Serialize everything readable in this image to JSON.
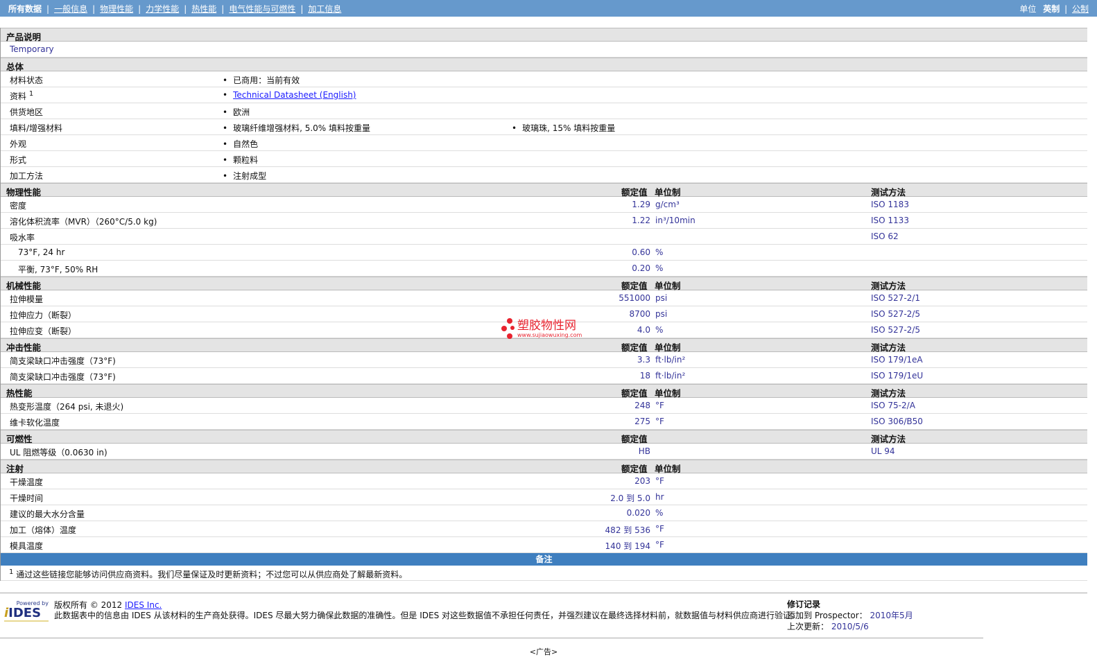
{
  "nav": {
    "items": [
      "所有数据",
      "一般信息",
      "物理性能",
      "力学性能",
      "热性能",
      "电气性能与可燃性",
      "加工信息"
    ],
    "right": {
      "label": "单位",
      "english": "英制",
      "metric": "公制"
    }
  },
  "product": {
    "title": "产品说明",
    "text": "Temporary"
  },
  "general": {
    "title": "总体",
    "rows": [
      {
        "label": "材料状态",
        "items": [
          "已商用：当前有效"
        ]
      },
      {
        "label": "资料",
        "sup": "1",
        "link": "Technical Datasheet (English)"
      },
      {
        "label": "供货地区",
        "items": [
          "欧洲"
        ]
      },
      {
        "label": "填料/增强材料",
        "items": [
          "玻璃纤维增强材料, 5.0% 填料按重量",
          "玻璃珠, 15% 填料按重量"
        ]
      },
      {
        "label": "外观",
        "items": [
          "自然色"
        ]
      },
      {
        "label": "形式",
        "items": [
          "颗粒料"
        ]
      },
      {
        "label": "加工方法",
        "items": [
          "注射成型"
        ]
      }
    ]
  },
  "headers": {
    "value": "额定值",
    "unit": "单位制",
    "method": "测试方法"
  },
  "sections": [
    {
      "title": "物理性能",
      "unit": true,
      "method": true,
      "rows": [
        {
          "label": "密度",
          "value": "1.29",
          "unit": "g/cm³",
          "method": "ISO 1183"
        },
        {
          "label": "溶化体积流率（MVR）（260°C/5.0 kg)",
          "value": "1.22",
          "unit": "in³/10min",
          "method": "ISO 1133"
        },
        {
          "label": "吸水率",
          "value": "",
          "unit": "",
          "method": "ISO 62"
        },
        {
          "label": "73°F, 24 hr",
          "indent": true,
          "value": "0.60",
          "unit": "%",
          "method": ""
        },
        {
          "label": "平衡, 73°F, 50% RH",
          "indent": true,
          "value": "0.20",
          "unit": "%",
          "method": ""
        }
      ]
    },
    {
      "title": "机械性能",
      "unit": true,
      "method": true,
      "rows": [
        {
          "label": "拉伸模量",
          "value": "551000",
          "unit": "psi",
          "method": "ISO 527-2/1"
        },
        {
          "label": "拉伸应力（断裂）",
          "value": "8700",
          "unit": "psi",
          "method": "ISO 527-2/5"
        },
        {
          "label": "拉伸应变（断裂）",
          "value": "4.0",
          "unit": "%",
          "method": "ISO 527-2/5"
        }
      ]
    },
    {
      "title": "冲击性能",
      "unit": true,
      "method": true,
      "rows": [
        {
          "label": "简支梁缺口冲击强度（73°F)",
          "value": "3.3",
          "unit": "ft·lb/in²",
          "method": "ISO 179/1eA"
        },
        {
          "label": "简支梁缺口冲击强度（73°F)",
          "value": "18",
          "unit": "ft·lb/in²",
          "method": "ISO 179/1eU"
        }
      ]
    },
    {
      "title": "热性能",
      "unit": true,
      "method": true,
      "rows": [
        {
          "label": "热变形温度（264 psi, 未退火)",
          "value": "248",
          "unit": "°F",
          "method": "ISO 75-2/A"
        },
        {
          "label": "维卡软化温度",
          "value": "275",
          "unit": "°F",
          "method": "ISO 306/B50"
        }
      ]
    },
    {
      "title": "可燃性",
      "unit": false,
      "method": true,
      "rows": [
        {
          "label": "UL 阻燃等级（0.0630 in)",
          "value": "HB",
          "unit": "",
          "method": "UL 94"
        }
      ]
    },
    {
      "title": "注射",
      "unit": true,
      "method": false,
      "rows": [
        {
          "label": "干燥温度",
          "value": "203",
          "unit": "°F",
          "method": ""
        },
        {
          "label": "干燥时间",
          "value": "2.0 到  5.0",
          "unit": "hr",
          "method": ""
        },
        {
          "label": "建议的最大水分含量",
          "value": "0.020",
          "unit": "%",
          "method": ""
        },
        {
          "label": "加工（熔体）温度",
          "value": "482 到  536",
          "unit": "°F",
          "method": ""
        },
        {
          "label": "模具温度",
          "value": "140 到  194",
          "unit": "°F",
          "method": ""
        }
      ]
    }
  ],
  "notes": {
    "title": "备注",
    "sup": "1",
    "text": "通过这些链接您能够访问供应商资料。我们尽量保证及时更新资料；不过您可以从供应商处了解最新资料。"
  },
  "watermark": {
    "text": "塑胶物性网",
    "url": "www.sujiaowuxing.com"
  },
  "footer": {
    "logo_powered": "Powered by",
    "logo": "IDES",
    "copyright": "版权所有 © 2012",
    "company_link": "IDES Inc.",
    "disclaimer": "此数据表中的信息由 IDES 从该材料的生产商处获得。IDES 尽最大努力确保此数据的准确性。但是 IDES 对这些数据值不承担任何责任，并强烈建议在最终选择材料前，就数据值与材料供应商进行验证。",
    "revision": {
      "title": "修订记录",
      "added_label": "添加到 Prospector：",
      "added": "2010年5月",
      "updated_label": "上次更新：",
      "updated": "2010/5/6"
    },
    "ad": "<广告>"
  }
}
